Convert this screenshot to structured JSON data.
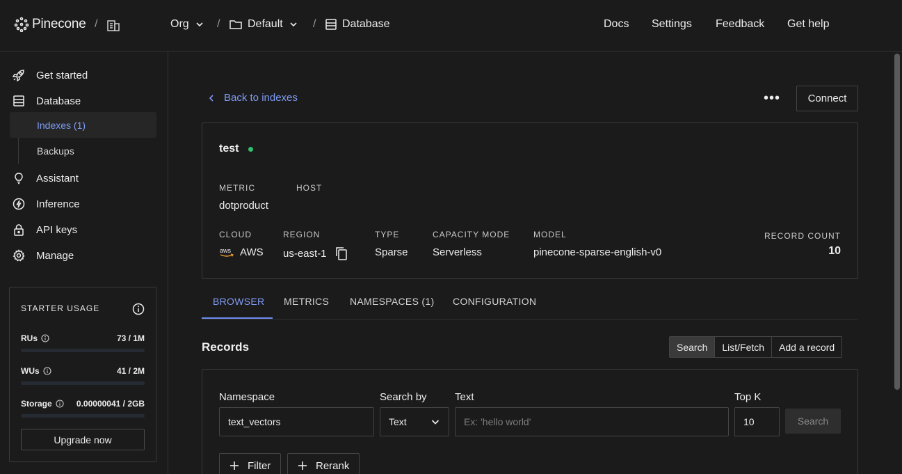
{
  "header": {
    "logo_text": "Pinecone",
    "org_label": "Org",
    "project_label": "Default",
    "section_label": "Database",
    "nav": [
      "Docs",
      "Settings",
      "Feedback",
      "Get help"
    ]
  },
  "sidebar": {
    "items": [
      {
        "label": "Get started",
        "icon": "rocket-icon"
      },
      {
        "label": "Database",
        "icon": "database-icon"
      },
      {
        "label": "Assistant",
        "icon": "lightbulb-icon"
      },
      {
        "label": "Inference",
        "icon": "bolt-icon"
      },
      {
        "label": "API keys",
        "icon": "lock-icon"
      },
      {
        "label": "Manage",
        "icon": "gear-icon"
      }
    ],
    "sub_items": [
      {
        "label": "Indexes (1)",
        "active": true
      },
      {
        "label": "Backups",
        "active": false
      }
    ],
    "usage": {
      "title": "STARTER USAGE",
      "rows": [
        {
          "label": "RUs",
          "value": "73 / 1M"
        },
        {
          "label": "WUs",
          "value": "41 / 2M"
        },
        {
          "label": "Storage",
          "value": "0.00000041 / 2GB"
        }
      ],
      "upgrade_label": "Upgrade now"
    }
  },
  "main": {
    "back_label": "Back to indexes",
    "more_label": "•••",
    "connect_label": "Connect",
    "index": {
      "name": "test",
      "status_color": "#2fbf71",
      "metric_label": "METRIC",
      "metric": "dotproduct",
      "host_label": "HOST",
      "cloud_label": "CLOUD",
      "cloud_logo": "aws",
      "cloud": "AWS",
      "region_label": "REGION",
      "region": "us-east-1",
      "type_label": "TYPE",
      "type": "Sparse",
      "capacity_label": "CAPACITY MODE",
      "capacity": "Serverless",
      "model_label": "MODEL",
      "model": "pinecone-sparse-english-v0",
      "record_count_label": "RECORD COUNT",
      "record_count": "10"
    },
    "tabs": [
      "BROWSER",
      "METRICS",
      "NAMESPACES (1)",
      "CONFIGURATION"
    ],
    "records": {
      "title": "Records",
      "modes": [
        "Search",
        "List/Fetch",
        "Add a record"
      ],
      "namespace_label": "Namespace",
      "namespace_value": "text_vectors",
      "search_by_label": "Search by",
      "search_by_value": "Text",
      "text_label": "Text",
      "text_placeholder": "Ex: 'hello world'",
      "topk_label": "Top K",
      "topk_value": "10",
      "search_button": "Search",
      "filter_button": "Filter",
      "rerank_button": "Rerank"
    }
  },
  "colors": {
    "accent": "#7f9cf5",
    "background": "#1b1b1b",
    "border": "#3a3a3a",
    "status": "#2fbf71"
  }
}
